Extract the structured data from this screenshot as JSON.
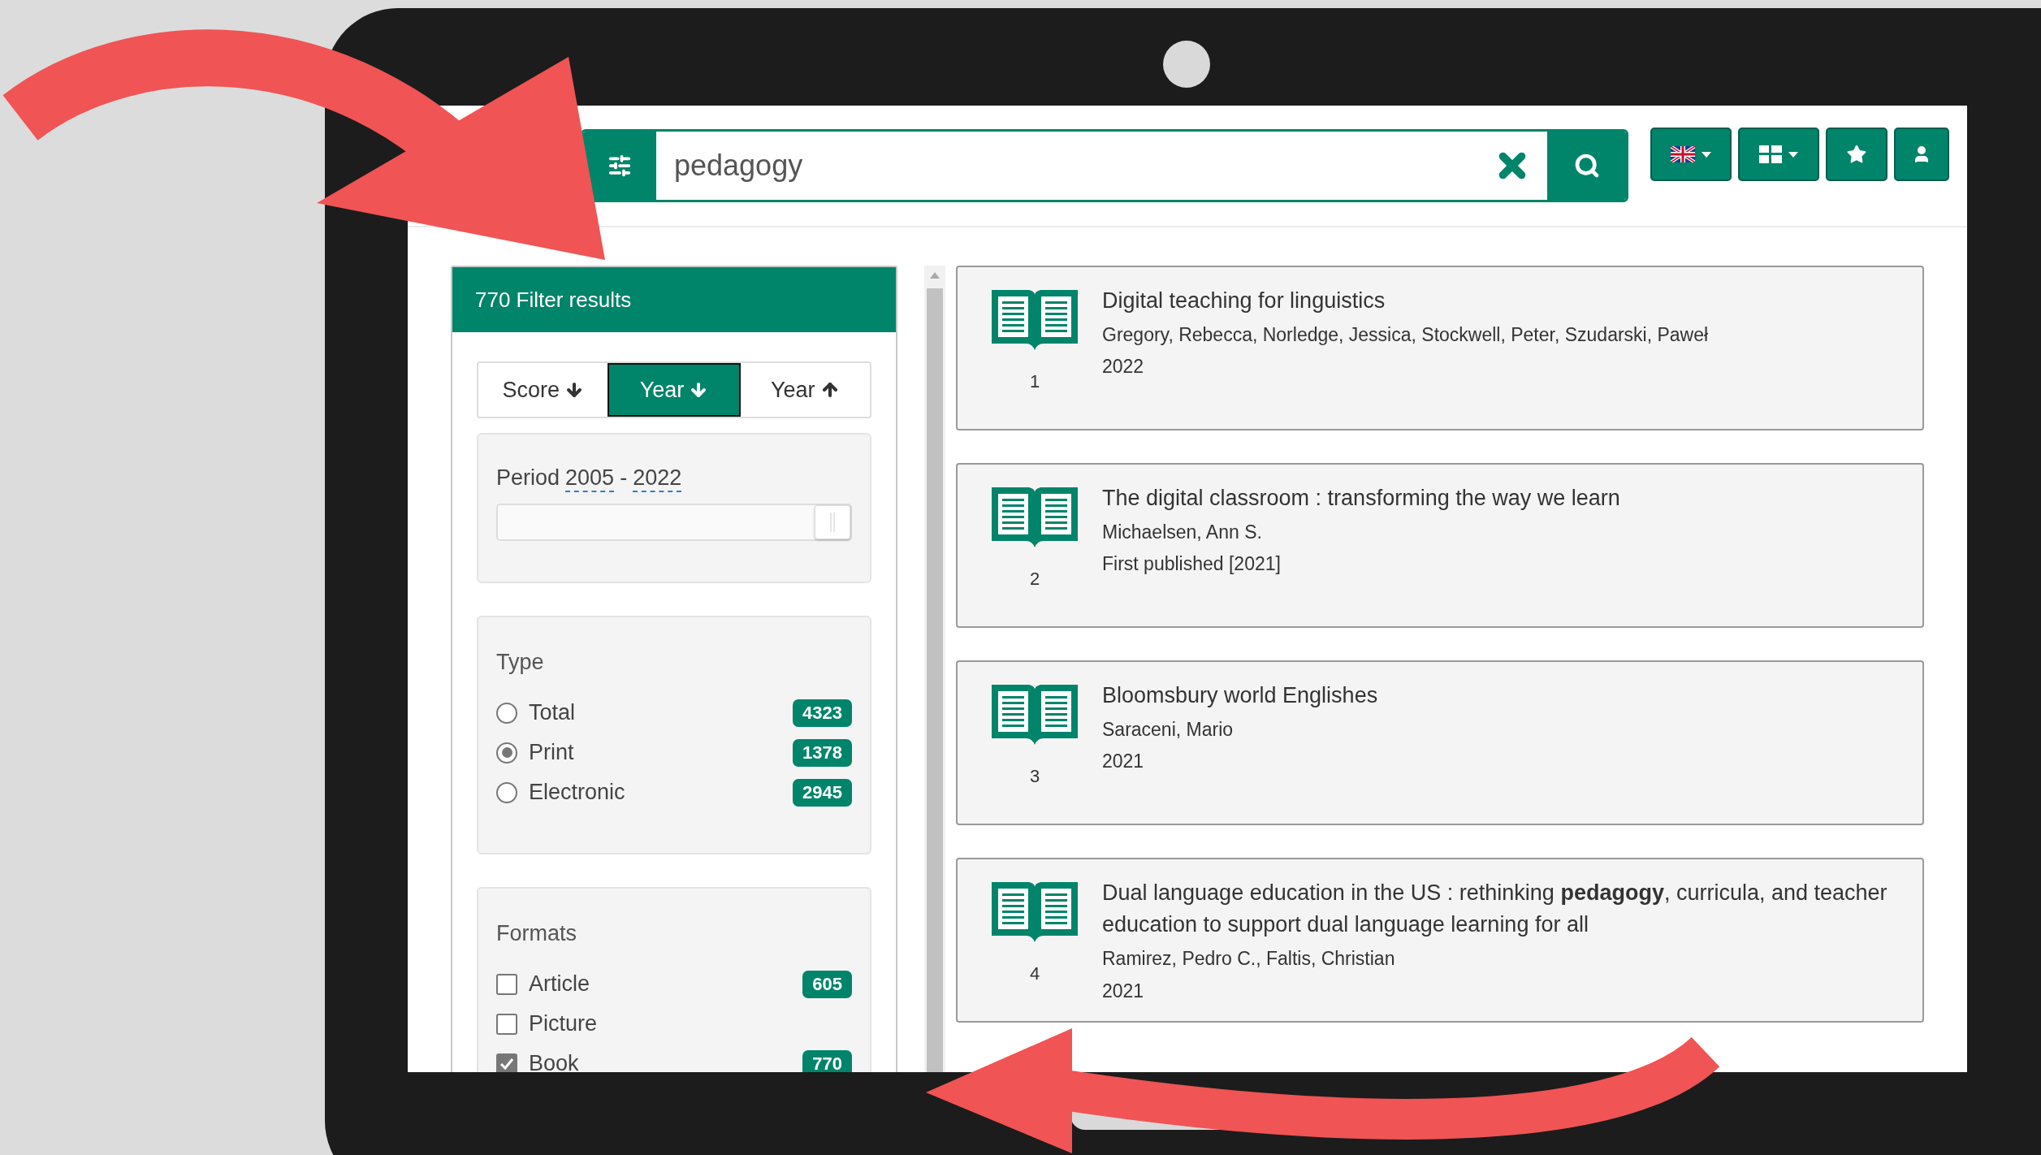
{
  "search": {
    "value": "pedagogy"
  },
  "toolbar": [
    {
      "kind": "language"
    },
    {
      "kind": "view"
    },
    {
      "kind": "favorites"
    },
    {
      "kind": "account"
    }
  ],
  "filters": {
    "title": "770 Filter results",
    "sort": [
      {
        "label": "Score",
        "kind": "descending",
        "selected": false
      },
      {
        "label": "Year",
        "kind": "descending",
        "selected": true
      },
      {
        "label": "Year",
        "kind": "ascending",
        "selected": false
      }
    ],
    "period": {
      "label": "Period",
      "from": "2005",
      "separator": "-",
      "to": "2022",
      "level": 1
    },
    "type": {
      "title": "Type",
      "options": [
        {
          "label": "Total",
          "count": "4323",
          "selected": false
        },
        {
          "label": "Print",
          "count": "1378",
          "selected": true
        },
        {
          "label": "Electronic",
          "count": "2945",
          "selected": false
        }
      ]
    },
    "formats": {
      "title": "Formats",
      "options": [
        {
          "label": "Article",
          "count": "605",
          "checked": false
        },
        {
          "label": "Picture",
          "checked": false
        },
        {
          "label": "Book",
          "count": "770",
          "checked": true
        }
      ]
    }
  },
  "results": [
    {
      "number": "1",
      "title": "Digital teaching for linguistics",
      "authors": "Gregory, Rebecca, Norledge, Jessica, Stockwell, Peter, Szudarski, Paweł",
      "year": "2022"
    },
    {
      "number": "2",
      "title": "The digital classroom : transforming the way we learn",
      "authors": "Michaelsen, Ann S.",
      "year": "First published [2021]"
    },
    {
      "number": "3",
      "title": "Bloomsbury world Englishes",
      "authors": "Saraceni, Mario",
      "year": "2021"
    },
    {
      "number": "4",
      "title": "Dual language education in the US : rethinking **pedagogy**, curricula, and teacher education to support dual language learning for all",
      "authors": "Ramirez, Pedro C., Faltis, Christian",
      "year": "2021"
    }
  ]
}
